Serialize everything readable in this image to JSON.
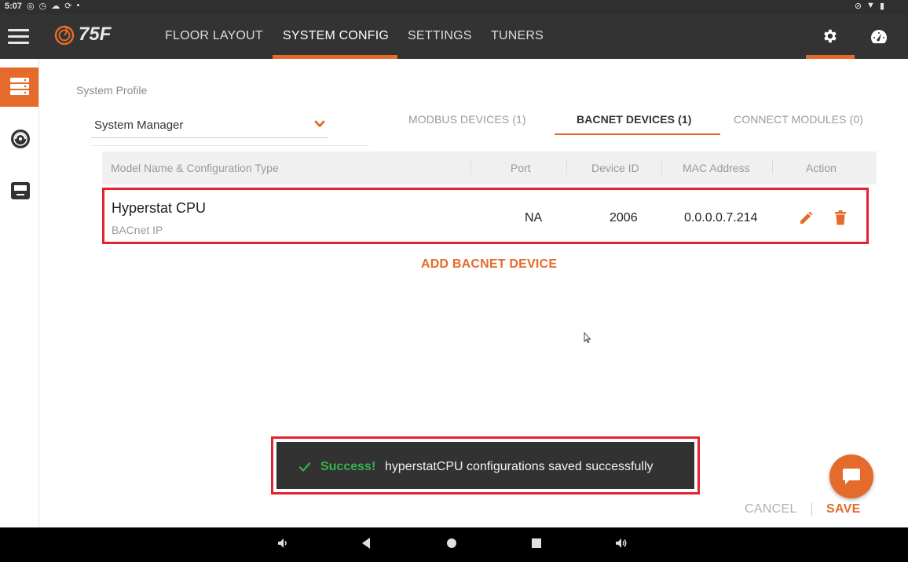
{
  "status_bar": {
    "time": "5:07"
  },
  "app": {
    "logo_text": "75F"
  },
  "nav": {
    "tabs": [
      {
        "label": "FLOOR LAYOUT"
      },
      {
        "label": "SYSTEM CONFIG"
      },
      {
        "label": "SETTINGS"
      },
      {
        "label": "TUNERS"
      }
    ],
    "active_tab": "SYSTEM CONFIG"
  },
  "rail": {
    "icons": [
      "system-config-icon",
      "dial-icon",
      "display-device-icon"
    ]
  },
  "system_profile": {
    "label": "System Profile",
    "selected": "System Manager"
  },
  "device_tabs": [
    {
      "label": "MODBUS DEVICES (1)"
    },
    {
      "label": "BACNET DEVICES (1)"
    },
    {
      "label": "CONNECT MODULES (0)"
    }
  ],
  "table": {
    "headers": [
      "Model Name & Configuration Type",
      "Port",
      "Device ID",
      "MAC Address",
      "Action"
    ],
    "rows": [
      {
        "name": "Hyperstat CPU",
        "type": "BACnet IP",
        "port": "NA",
        "device_id": "2006",
        "mac": "0.0.0.0.7.214"
      }
    ]
  },
  "add_button": "ADD BACNET DEVICE",
  "toast": {
    "status": "Success!",
    "message": "hyperstatCPU configurations saved successfully"
  },
  "footer": {
    "cancel": "CANCEL",
    "save": "SAVE"
  },
  "colors": {
    "accent": "#e46b2b",
    "topbar": "#333333",
    "highlight_border": "#e52230",
    "success": "#37b24d"
  }
}
